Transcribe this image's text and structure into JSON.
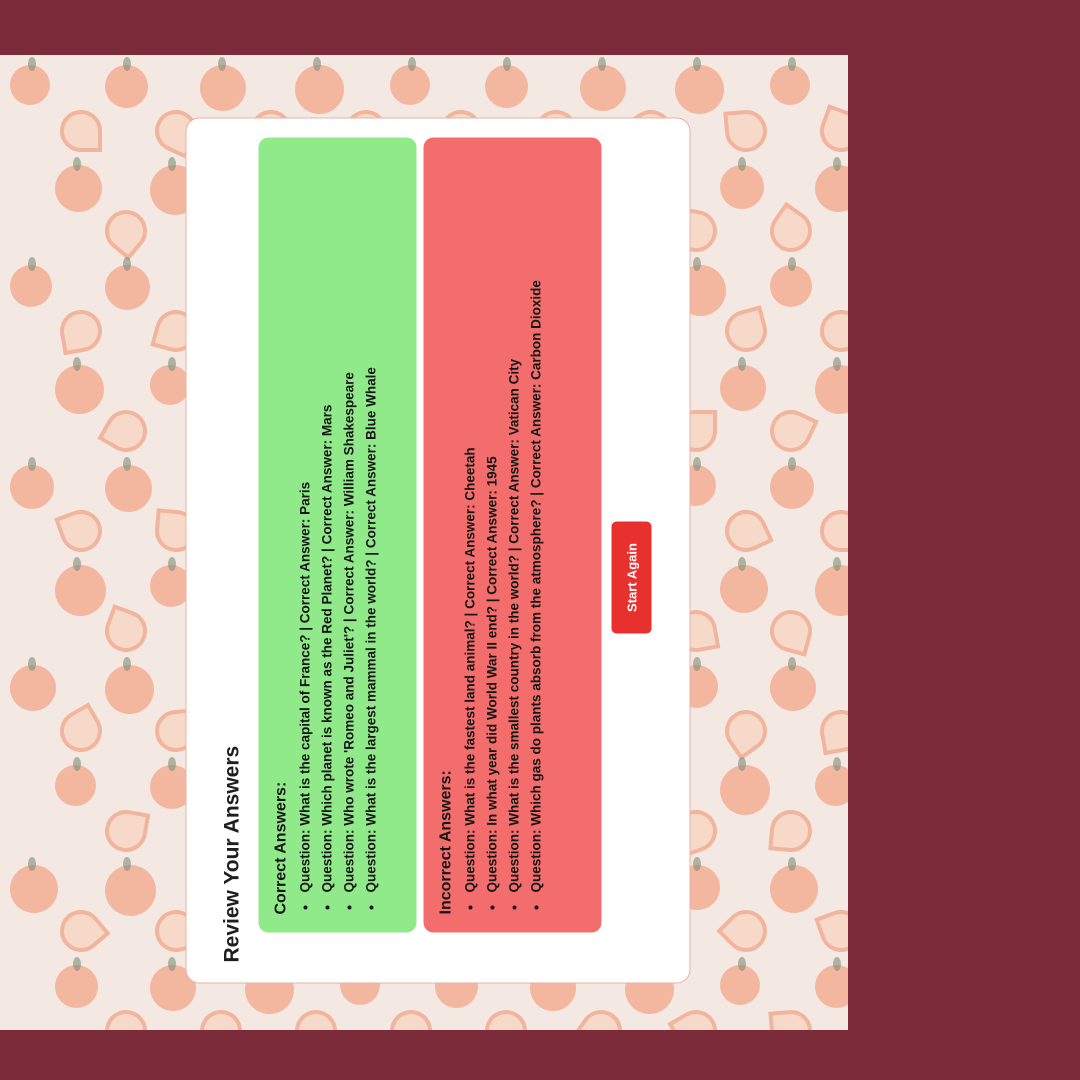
{
  "page_title": "Review Your Answers",
  "correct": {
    "heading": "Correct Answers:",
    "items": [
      "Question: What is the capital of France? | Correct Answer: Paris",
      "Question: Which planet is known as the Red Planet? | Correct Answer: Mars",
      "Question: Who wrote 'Romeo and Juliet'? | Correct Answer: William Shakespeare",
      "Question: What is the largest mammal in the world? | Correct Answer: Blue Whale"
    ]
  },
  "incorrect": {
    "heading": "Incorrect Answers:",
    "items": [
      "Question: What is the fastest land animal? | Correct Answer: Cheetah",
      "Question: In what year did World War II end? | Correct Answer: 1945",
      "Question: What is the smallest country in the world? | Correct Answer: Vatican City",
      "Question: Which gas do plants absorb from the atmosphere? | Correct Answer: Carbon Dioxide"
    ]
  },
  "start_again_label": "Start Again",
  "colors": {
    "outer_background": "#7c2b3b",
    "correct_panel": "#90ea8a",
    "incorrect_panel": "#f26d6b",
    "button": "#e8312f"
  }
}
